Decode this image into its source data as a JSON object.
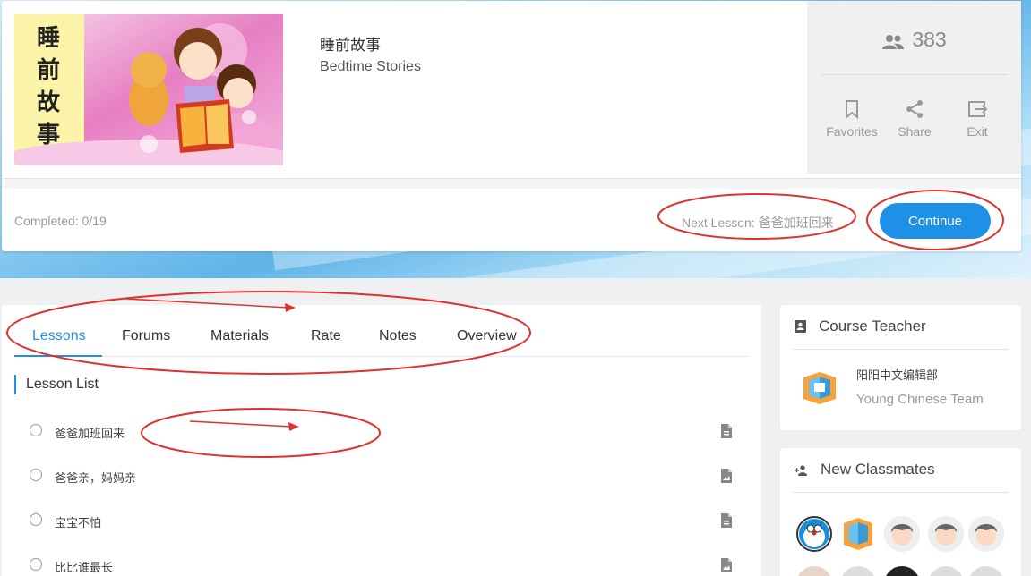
{
  "course": {
    "title_cn": "睡前故事",
    "title_en": "Bedtime Stories",
    "cover_title": "睡前故事",
    "member_count": "383",
    "actions": {
      "favorites": "Favorites",
      "share": "Share",
      "exit": "Exit"
    },
    "completed": "Completed: 0/19",
    "next_lesson": "Next Lesson: 爸爸加班回来",
    "continue_label": "Continue"
  },
  "tabs": [
    {
      "label": "Lessons",
      "active": true
    },
    {
      "label": "Forums",
      "active": false
    },
    {
      "label": "Materials",
      "active": false
    },
    {
      "label": "Rate",
      "active": false
    },
    {
      "label": "Notes",
      "active": false
    },
    {
      "label": "Overview",
      "active": false
    }
  ],
  "lesson_list": {
    "title": "Lesson List",
    "items": [
      {
        "name": "爸爸加班回来"
      },
      {
        "name": "爸爸亲，妈妈亲"
      },
      {
        "name": "宝宝不怕"
      },
      {
        "name": "比比谁最长"
      }
    ]
  },
  "teacher": {
    "heading": "Course Teacher",
    "name_cn": "阳阳中文编辑部",
    "name_en": "Young Chinese Team"
  },
  "classmates": {
    "heading": "New Classmates"
  },
  "colors": {
    "accent": "#1e90e6",
    "annotation": "#e0322c"
  }
}
